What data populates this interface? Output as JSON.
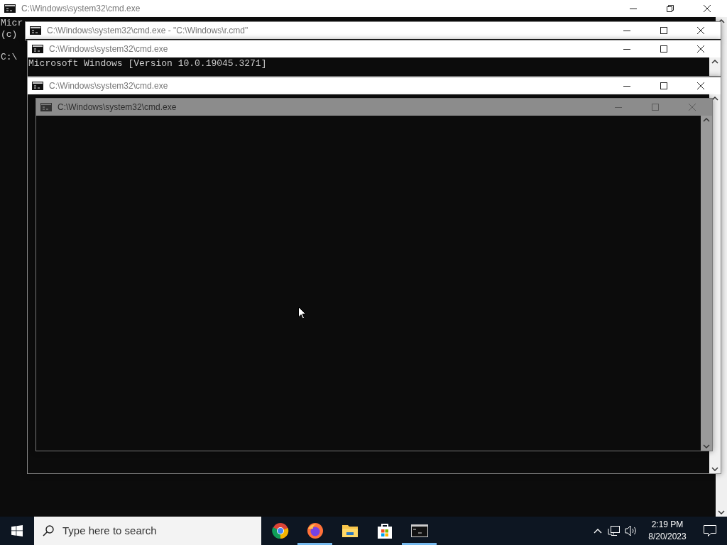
{
  "windows": [
    {
      "title": "C:\\Windows\\system32\\cmd.exe",
      "kind": "normal",
      "maximized": true,
      "lines": [
        "Micr",
        "(c)",
        "C:\\"
      ]
    },
    {
      "title": "C:\\Windows\\system32\\cmd.exe - \"C:\\Windows\\r.cmd\"",
      "kind": "normal",
      "maximized": false
    },
    {
      "title": "C:\\Windows\\system32\\cmd.exe",
      "kind": "normal",
      "maximized": false,
      "lines": [
        "Microsoft Windows [Version 10.0.19045.3271]"
      ]
    },
    {
      "title": "C:\\Windows\\system32\\cmd.exe",
      "kind": "normal",
      "maximized": false
    },
    {
      "title": "C:\\Windows\\system32\\cmd.exe",
      "kind": "ghost",
      "maximized": false
    }
  ],
  "taskbar": {
    "search": {
      "placeholder": "Type here to search"
    },
    "apps": [
      {
        "kind": "chrome",
        "running": false
      },
      {
        "kind": "firefox",
        "running": true
      },
      {
        "kind": "explorer",
        "running": false
      },
      {
        "kind": "store",
        "running": false
      },
      {
        "kind": "terminal",
        "running": true
      }
    ],
    "time": "2:19 PM",
    "date": "8/20/2023"
  }
}
